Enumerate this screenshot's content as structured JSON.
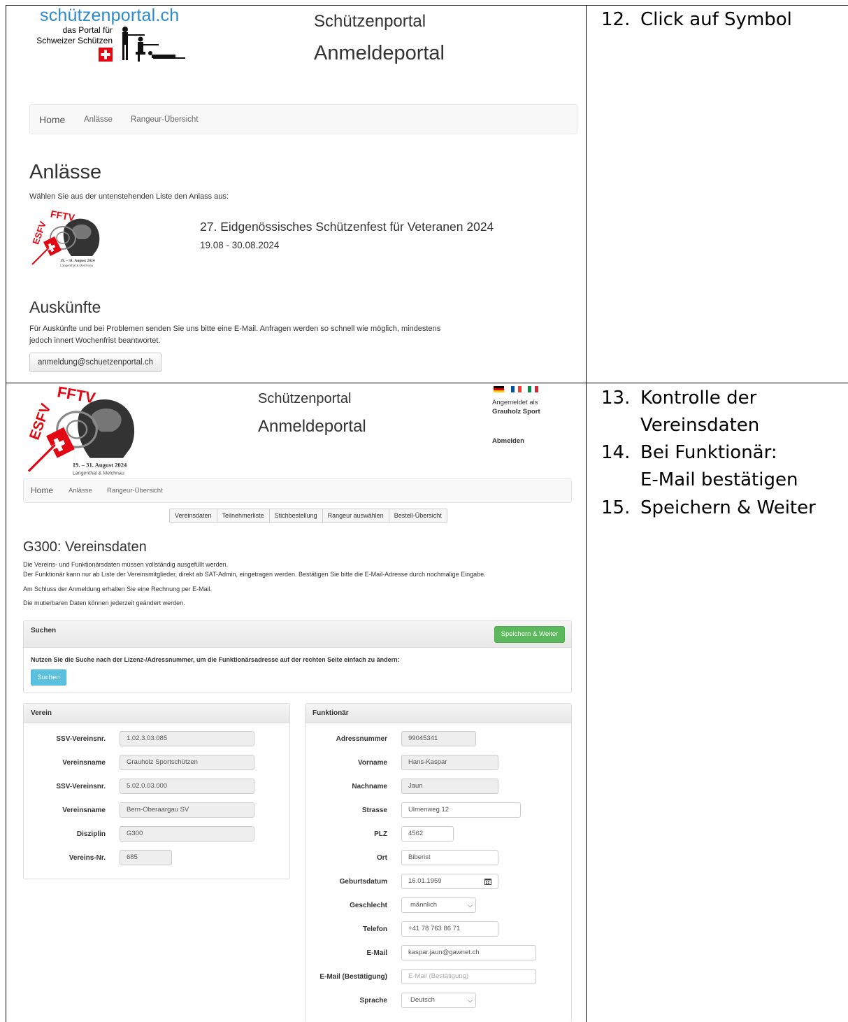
{
  "instructions": {
    "step12": {
      "num": "12.",
      "text": "Click auf Symbol"
    },
    "step13": {
      "num": "13.",
      "line1": "Kontrolle der",
      "line2": "Vereinsdaten"
    },
    "step14": {
      "num": "14.",
      "line1": "Bei Funktionär:",
      "line2": "E-Mail bestätigen"
    },
    "step15": {
      "num": "15.",
      "text": "Speichern & Weiter"
    }
  },
  "panel1": {
    "logo_text": "schützenportal.ch",
    "logo_sub1": "das Portal für",
    "logo_sub2": "Schweizer Schützen",
    "site_title": "Schützenportal",
    "site_subtitle": "Anmeldeportal",
    "nav": {
      "home": "Home",
      "events": "Anlässe",
      "rangeur": "Rangeur-Übersicht"
    },
    "heading": "Anlässe",
    "intro": "Wählen Sie aus der untenstehenden Liste den Anlass aus:",
    "event_logo": {
      "top": "FFTV",
      "side": "ESFV",
      "date": "19. – 31. August 2024",
      "place": "Langenthal & Melchnau"
    },
    "event_title": "27. Eidgenössisches Schützenfest für Veteranen 2024",
    "event_date": "19.08 - 30.08.2024",
    "info_heading": "Auskünfte",
    "info_text1": "Für Auskünfte und bei Problemen senden Sie uns bitte eine E-Mail. Anfragen werden so schnell wie möglich, mindestens",
    "info_text2": "jedoch innert Wochenfrist beantwortet.",
    "email_button": "anmeldung@schuetzenportal.ch"
  },
  "panel2": {
    "logo": {
      "top": "FFTV",
      "side": "ESFV",
      "date": "19. – 31. August 2024",
      "place": "Langenthal & Melchnau"
    },
    "site_title": "Schützenportal",
    "site_subtitle": "Anmeldeportal",
    "logged_in_label": "Angemeldet als",
    "logged_in_user": "Grauholz Sport",
    "logout": "Abmelden",
    "nav": {
      "home": "Home",
      "events": "Anlässe",
      "rangeur": "Rangeur-Übersicht"
    },
    "tabs": [
      "Vereinsdaten",
      "Teilnehmerliste",
      "Stichbestellung",
      "Rangeur auswählen",
      "Bestell-Übersicht"
    ],
    "heading": "G300: Vereinsdaten",
    "desc1": "Die Vereins- und Funktionärsdaten müssen vollständig ausgefüllt werden.",
    "desc2": "Der Funktionär kann nur ab Liste der Vereinsmitglieder, direkt ab SAT-Admin, eingetragen werden. Bestätigen Sie bitte die E-Mail-Adresse durch nochmalige Eingabe.",
    "desc3": "Am Schluss der Anmeldung erhalten Sie eine Rechnung per E-Mail.",
    "desc4": "Die mutierbaren Daten können jederzeit geändert werden.",
    "search_panel": {
      "title": "Suchen",
      "save_button": "Speichern & Weiter",
      "hint": "Nutzen Sie die Suche nach der Lizenz-/Adressnummer, um die Funktionärsadresse auf der rechten Seite einfach zu ändern:",
      "search_button": "Suchen"
    },
    "verein": {
      "title": "Verein",
      "fields": [
        {
          "label": "SSV-Vereinsnr.",
          "value": "1.02.3.03.085"
        },
        {
          "label": "Vereinsname",
          "value": "Grauholz Sportschützen"
        },
        {
          "label": "SSV-Vereinsnr.",
          "value": "5.02.0.03.000"
        },
        {
          "label": "Vereinsname",
          "value": "Bern-Oberaargau SV"
        },
        {
          "label": "Disziplin",
          "value": "G300"
        },
        {
          "label": "Vereins-Nr.",
          "value": "685"
        }
      ]
    },
    "funktionaer": {
      "title": "Funktionär",
      "fields": [
        {
          "label": "Adressnummer",
          "value": "99045341"
        },
        {
          "label": "Vorname",
          "value": "Hans-Kaspar"
        },
        {
          "label": "Nachname",
          "value": "Jaun"
        },
        {
          "label": "Strasse",
          "value": "Ulmenweg 12"
        },
        {
          "label": "PLZ",
          "value": "4562"
        },
        {
          "label": "Ort",
          "value": "Biberist"
        },
        {
          "label": "Geburtsdatum",
          "value": "16.01.1959"
        },
        {
          "label": "Geschlecht",
          "value": "männlich"
        },
        {
          "label": "Telefon",
          "value": "+41 78 763 86 71"
        },
        {
          "label": "E-Mail",
          "value": "kaspar.jaun@gawnet.ch"
        },
        {
          "label": "E-Mail (Bestätigung)",
          "placeholder": "E-Mail (Bestätigung)"
        },
        {
          "label": "Sprache",
          "value": "Deutsch"
        }
      ]
    }
  }
}
